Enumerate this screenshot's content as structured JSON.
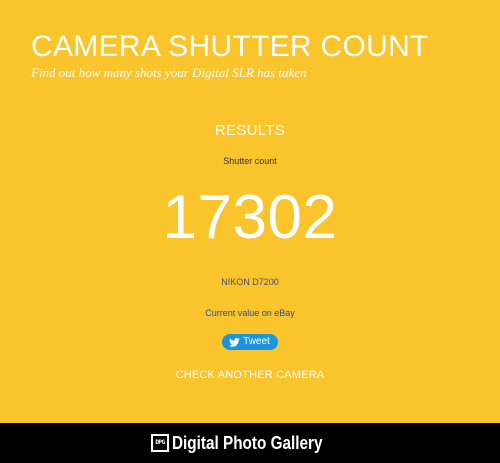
{
  "header": {
    "title": "CAMERA SHUTTER COUNT",
    "subtitle": "Find out how many shots your Digital SLR has taken"
  },
  "results": {
    "heading": "RESULTS",
    "count_label": "Shutter count",
    "count_value": "17302",
    "camera_model": "NIKON D7200",
    "ebay_link": "Current value on eBay",
    "tweet_label": "Tweet",
    "check_another": "CHECK ANOTHER CAMERA"
  },
  "footer": {
    "logo_mark": "DPG",
    "brand": "Digital Photo Gallery"
  },
  "colors": {
    "background": "#f9c42c",
    "text_primary": "#ffffff",
    "tweet_button": "#1b95e0",
    "footer_background": "#000000"
  },
  "icons": {
    "tweet": "twitter-bird-icon",
    "footer_logo": "dpg-logo-icon"
  }
}
